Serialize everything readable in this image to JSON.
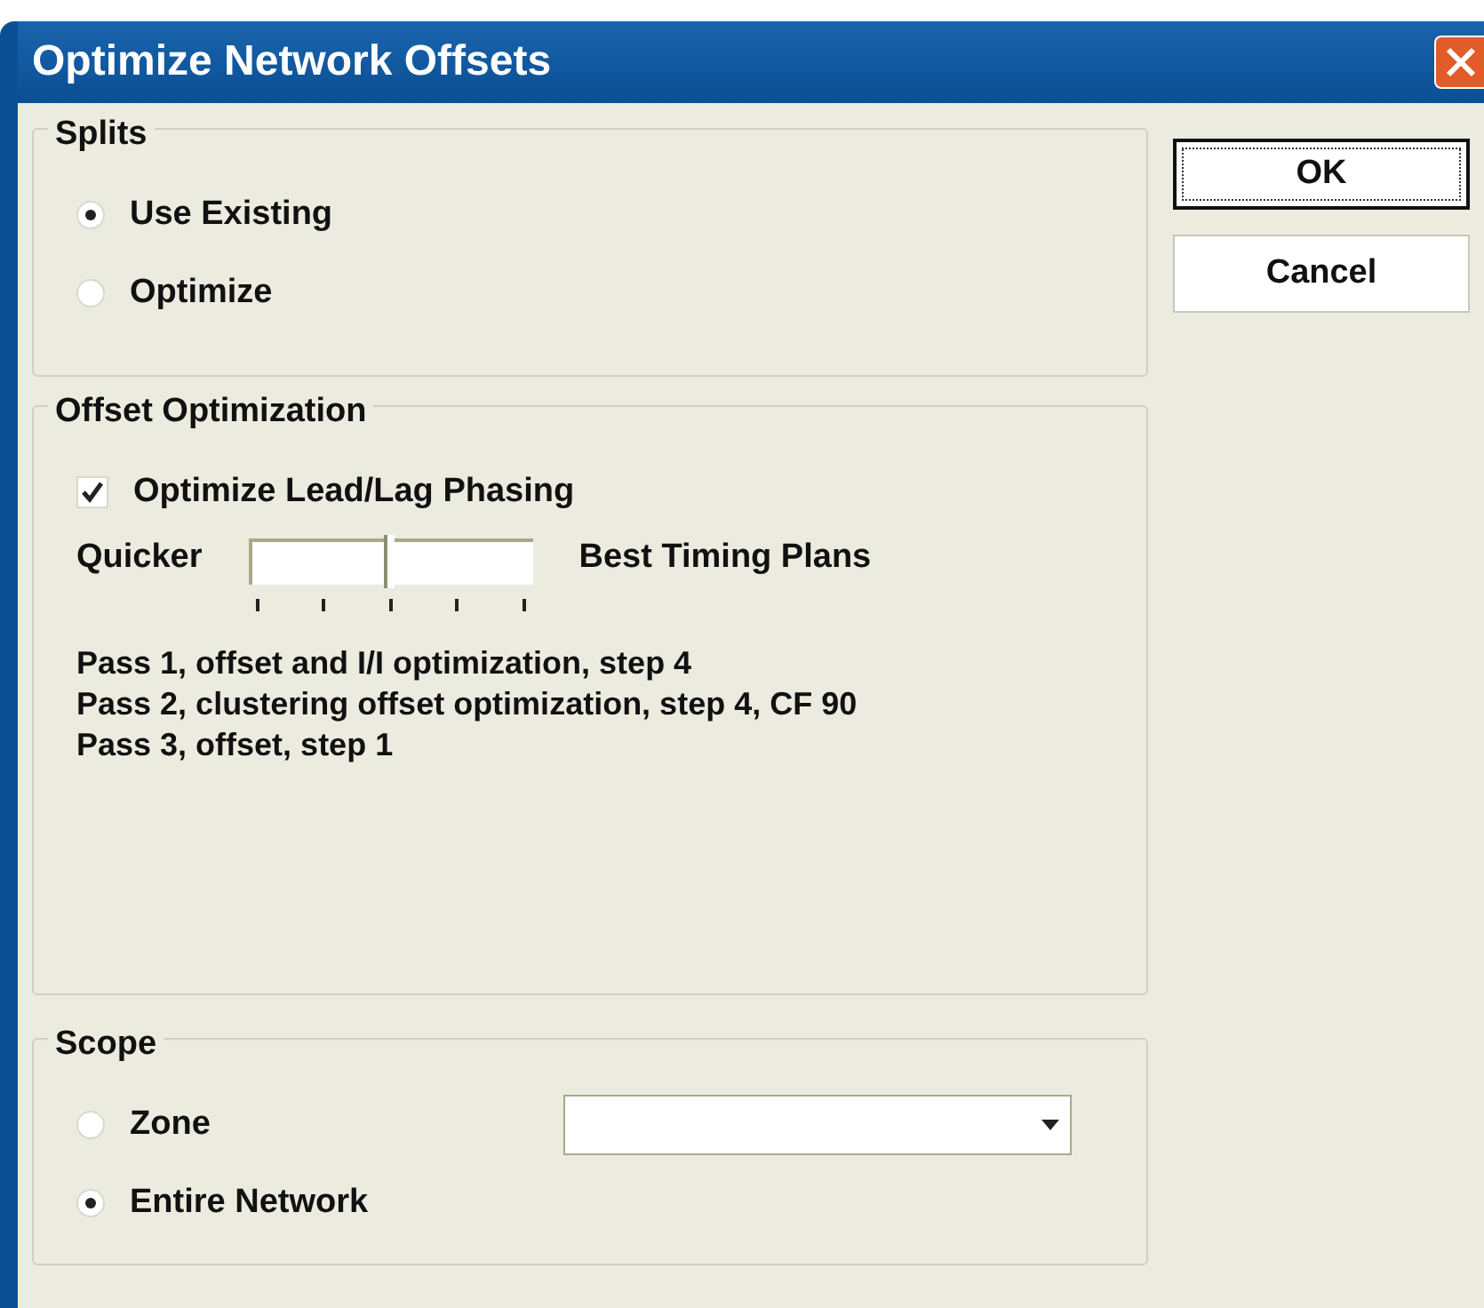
{
  "window": {
    "title": "Optimize Network Offsets"
  },
  "splits": {
    "title": "Splits",
    "options": [
      {
        "label": "Use Existing",
        "selected": true
      },
      {
        "label": "Optimize",
        "selected": false
      }
    ]
  },
  "offset_optimization": {
    "title": "Offset Optimization",
    "lead_lag": {
      "label": "Optimize Lead/Lag Phasing",
      "checked": true
    },
    "slider": {
      "left_label": "Quicker",
      "right_label": "Best Timing Plans",
      "level": 0.5
    },
    "passes": [
      "Pass 1, offset and I/I optimization, step 4",
      "Pass 2, clustering offset optimization, step 4, CF 90",
      "Pass 3, offset, step 1"
    ]
  },
  "scope": {
    "title": "Scope",
    "options": [
      {
        "label": "Zone",
        "selected": false
      },
      {
        "label": "Entire Network",
        "selected": true
      }
    ]
  },
  "buttons": [
    {
      "label": "OK",
      "default": true
    },
    {
      "label": "Cancel",
      "default": false
    }
  ]
}
